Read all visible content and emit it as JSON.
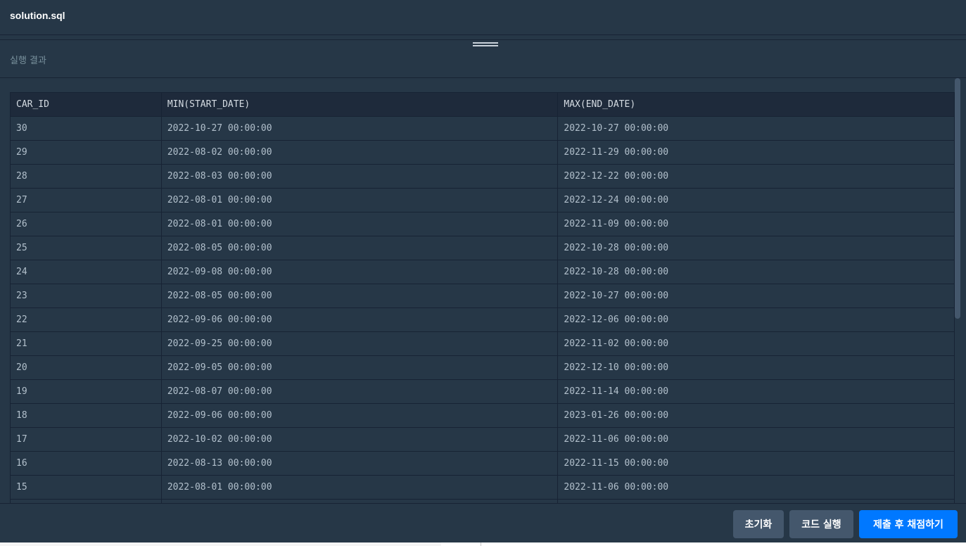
{
  "editor": {
    "file_name": "solution.sql"
  },
  "result": {
    "title": "실행 결과",
    "columns": [
      "CAR_ID",
      "MIN(START_DATE)",
      "MAX(END_DATE)"
    ],
    "rows": [
      [
        "30",
        "2022-10-27 00:00:00",
        "2022-10-27 00:00:00"
      ],
      [
        "29",
        "2022-08-02 00:00:00",
        "2022-11-29 00:00:00"
      ],
      [
        "28",
        "2022-08-03 00:00:00",
        "2022-12-22 00:00:00"
      ],
      [
        "27",
        "2022-08-01 00:00:00",
        "2022-12-24 00:00:00"
      ],
      [
        "26",
        "2022-08-01 00:00:00",
        "2022-11-09 00:00:00"
      ],
      [
        "25",
        "2022-08-05 00:00:00",
        "2022-10-28 00:00:00"
      ],
      [
        "24",
        "2022-09-08 00:00:00",
        "2022-10-28 00:00:00"
      ],
      [
        "23",
        "2022-08-05 00:00:00",
        "2022-10-27 00:00:00"
      ],
      [
        "22",
        "2022-09-06 00:00:00",
        "2022-12-06 00:00:00"
      ],
      [
        "21",
        "2022-09-25 00:00:00",
        "2022-11-02 00:00:00"
      ],
      [
        "20",
        "2022-09-05 00:00:00",
        "2022-12-10 00:00:00"
      ],
      [
        "19",
        "2022-08-07 00:00:00",
        "2022-11-14 00:00:00"
      ],
      [
        "18",
        "2022-09-06 00:00:00",
        "2023-01-26 00:00:00"
      ],
      [
        "17",
        "2022-10-02 00:00:00",
        "2022-11-06 00:00:00"
      ],
      [
        "16",
        "2022-08-13 00:00:00",
        "2022-11-15 00:00:00"
      ],
      [
        "15",
        "2022-08-01 00:00:00",
        "2022-11-06 00:00:00"
      ],
      [
        "",
        "",
        ""
      ]
    ]
  },
  "footer": {
    "reset_label": "초기화",
    "run_label": "코드 실행",
    "submit_label": "제출 후 채점하기"
  },
  "colors": {
    "background": "#263747",
    "header_row": "#1e2a3b",
    "border": "#172334",
    "secondary_button": "#44576c",
    "primary_button": "#0078ff"
  }
}
